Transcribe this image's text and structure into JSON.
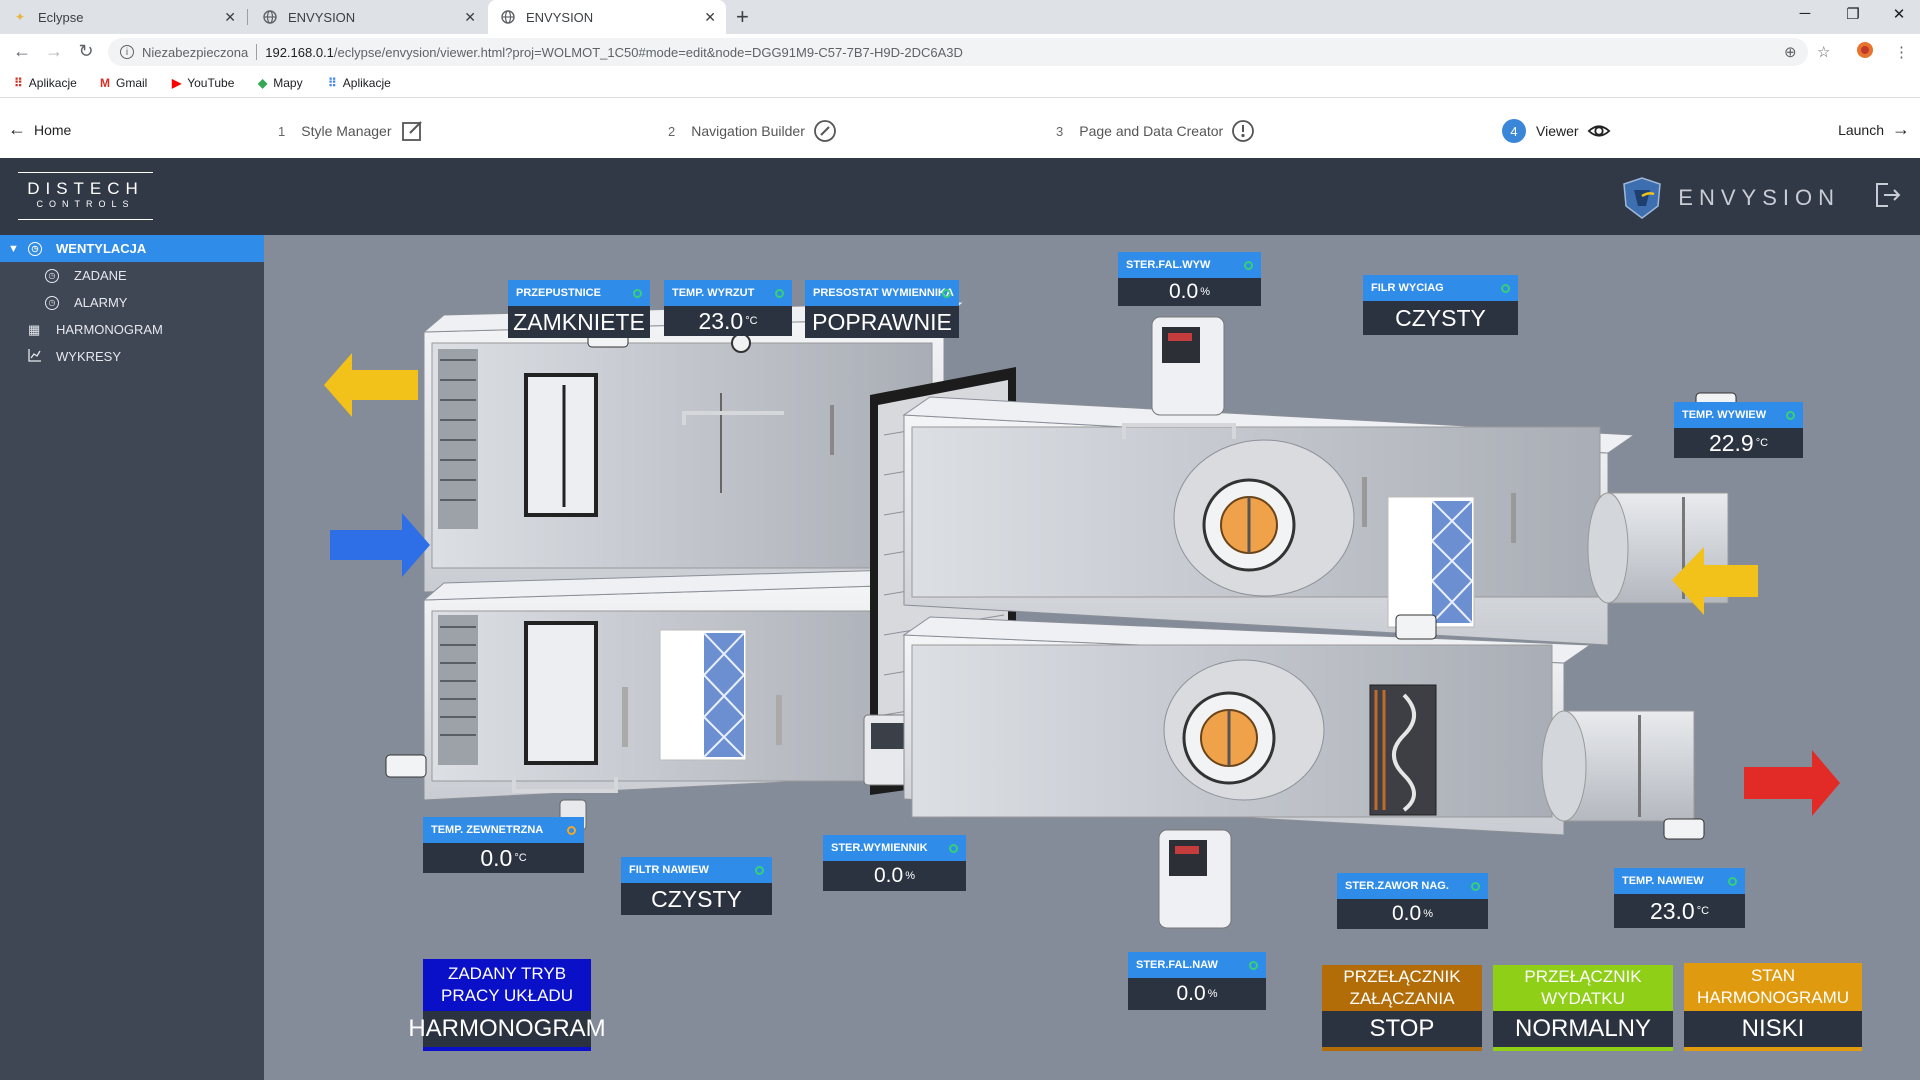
{
  "browser": {
    "tabs": [
      {
        "title": "Eclypse",
        "active": false
      },
      {
        "title": "ENVYSION",
        "active": false
      },
      {
        "title": "ENVYSION",
        "active": true
      }
    ],
    "security_label": "Niezabezpieczona",
    "url_host": "192.168.0.1",
    "url_path": "/eclypse/envysion/viewer.html?proj=WOLMOT_1C50#mode=edit&node=DGG91M9-C57-7B7-H9D-2DC6A3D",
    "bookmarks": [
      "Aplikacje",
      "Gmail",
      "YouTube",
      "Mapy",
      "Aplikacje"
    ]
  },
  "stepper": {
    "home": "Home",
    "steps": [
      {
        "num": "1",
        "label": "Style Manager"
      },
      {
        "num": "2",
        "label": "Navigation Builder"
      },
      {
        "num": "3",
        "label": "Page and Data Creator"
      },
      {
        "num": "4",
        "label": "Viewer"
      }
    ],
    "launch": "Launch"
  },
  "header": {
    "logo_line1": "DISTECH",
    "logo_line2": "CONTROLS",
    "app_name": "ENVYSION"
  },
  "sidebar": {
    "items": [
      {
        "label": "WENTYLACJA",
        "active": true
      },
      {
        "label": "ZADANE",
        "active": false
      },
      {
        "label": "ALARMY",
        "active": false
      },
      {
        "label": "HARMONOGRAM",
        "active": false
      },
      {
        "label": "WYKRESY",
        "active": false
      }
    ]
  },
  "tiles": {
    "przepustnice": {
      "label": "PRZEPUSTNICE",
      "value": "ZAMKNIETE"
    },
    "temp_wyrzut": {
      "label": "TEMP. WYRZUT",
      "value": "23.0",
      "unit": "°C"
    },
    "presostat": {
      "label": "PRESOSTAT WYMIENNIKA",
      "value": "POPRAWNIE"
    },
    "ster_fal_wyw": {
      "label": "STER.FAL.WYW",
      "value": "0.0",
      "unit": "%"
    },
    "filr_wyciag": {
      "label": "FILR WYCIAG",
      "value": "CZYSTY"
    },
    "temp_wywiew": {
      "label": "TEMP. WYWIEW",
      "value": "22.9",
      "unit": "°C"
    },
    "temp_zewnetrzna": {
      "label": "TEMP. ZEWNETRZNA",
      "value": "0.0",
      "unit": "°C"
    },
    "filtr_nawiew": {
      "label": "FILTR NAWIEW",
      "value": "CZYSTY"
    },
    "ster_wymiennik": {
      "label": "STER.WYMIENNIK",
      "value": "0.0",
      "unit": "%"
    },
    "ster_zawor_nag": {
      "label": "STER.ZAWOR NAG.",
      "value": "0.0",
      "unit": "%"
    },
    "temp_nawiew": {
      "label": "TEMP. NAWIEW",
      "value": "23.0",
      "unit": "°C"
    },
    "ster_fal_naw": {
      "label": "STER.FAL.NAW",
      "value": "0.0",
      "unit": "%"
    }
  },
  "big_tiles": {
    "zadany_tryb": {
      "label": "ZADANY TRYB  PRACY UKŁADU",
      "value": "HARMONOGRAM",
      "color": "#0a10c8"
    },
    "przelacznik_zal": {
      "label": "PRZEŁĄCZNIK ZAŁĄCZANIA",
      "value": "STOP",
      "color": "#b26d08"
    },
    "przelacznik_wyd": {
      "label": "PRZEŁĄCZNIK WYDATKU",
      "value": "NORMALNY",
      "color": "#8fcf18"
    },
    "stan_harm": {
      "label": "STAN HARMONOGRAMU",
      "value": "NISKI",
      "color": "#e09a10"
    }
  },
  "colors": {
    "accent": "#2f8ce8",
    "header_bg": "#313846",
    "sidebar_bg": "#3f4654",
    "canvas_bg": "#858c99",
    "tile_value_bg": "#2c3340"
  }
}
